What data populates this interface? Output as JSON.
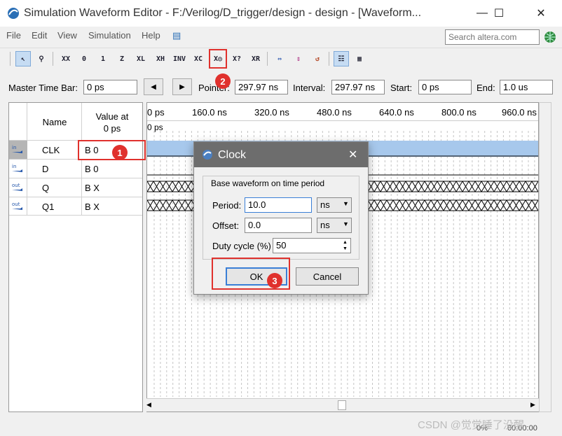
{
  "window": {
    "title": "Simulation Waveform Editor - F:/Verilog/D_trigger/design - design - [Waveform..."
  },
  "menu": [
    "File",
    "Edit",
    "View",
    "Simulation",
    "Help"
  ],
  "search": {
    "placeholder": "Search altera.com"
  },
  "toolbar": {
    "buttons": [
      "select-tool",
      "zoom-tool",
      "force-unknown",
      "force-low",
      "force-high",
      "force-high-impedance",
      "invert",
      "overwrite-clock",
      "count-value",
      "overwrite-value",
      "random-values",
      "snap-to-grid"
    ]
  },
  "timebar": {
    "master_label": "Master Time Bar:",
    "master_value": "0 ps",
    "pointer_label": "Pointer:",
    "pointer_value": "297.97 ns",
    "interval_label": "Interval:",
    "interval_value": "297.97 ns",
    "start_label": "Start:",
    "start_value": "0 ps",
    "end_label": "End:",
    "end_value": "1.0 us"
  },
  "signals_header": {
    "name": "Name",
    "value_at_line1": "Value at",
    "value_at_line2": "0 ps"
  },
  "signals": [
    {
      "dir": "in",
      "name": "CLK",
      "value": "B 0"
    },
    {
      "dir": "in",
      "name": "D",
      "value": "B 0"
    },
    {
      "dir": "out",
      "name": "Q",
      "value": "B X"
    },
    {
      "dir": "out",
      "name": "Q1",
      "value": "B X"
    }
  ],
  "ruler": {
    "ticks": [
      "0 ps",
      "160.0 ns",
      "320.0 ns",
      "480.0 ns",
      "640.0 ns",
      "800.0 ns",
      "960.0 ns"
    ],
    "cursor": "0 ps"
  },
  "dialog": {
    "title": "Clock",
    "group_label": "Base waveform on time period",
    "period_label": "Period:",
    "period_value": "10.0",
    "period_unit": "ns",
    "offset_label": "Offset:",
    "offset_value": "0.0",
    "offset_unit": "ns",
    "duty_label": "Duty cycle (%):",
    "duty_value": "50",
    "ok": "OK",
    "cancel": "Cancel"
  },
  "annotations": [
    "1",
    "2",
    "3"
  ],
  "status": {
    "zoom": "0%",
    "time": "00:00:00"
  },
  "watermark": "CSDN @觉觉睡了没醒",
  "colors": {
    "accent_red": "#e0312d",
    "clk_highlight": "#a7c8ec",
    "dialog_title": "#6d6d6d"
  }
}
